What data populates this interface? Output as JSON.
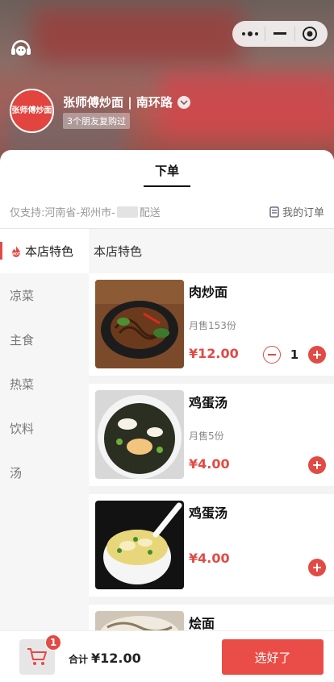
{
  "shop": {
    "name": "张师傅炒面 | 南环路",
    "logo_text": "张师傅炒面",
    "friends_badge": "3个朋友复购过"
  },
  "tabs": [
    {
      "label": "下单"
    }
  ],
  "notice": {
    "prefix": "仅支持:河南省-郑州市-",
    "suffix": "配送",
    "orders_link": "我的订单"
  },
  "categories": [
    {
      "label": "本店特色",
      "active": true
    },
    {
      "label": "凉菜"
    },
    {
      "label": "主食"
    },
    {
      "label": "热菜"
    },
    {
      "label": "饮料"
    },
    {
      "label": "汤"
    }
  ],
  "menu": {
    "section_title": "本店特色",
    "items": [
      {
        "name": "肉炒面",
        "sold": "月售153份",
        "price": "¥12.00",
        "count": "1"
      },
      {
        "name": "鸡蛋汤",
        "sold": "月售5份",
        "price": "¥4.00"
      },
      {
        "name": "鸡蛋汤",
        "sold": "",
        "price": "¥4.00"
      },
      {
        "name": "烩面",
        "sold": "",
        "price": ""
      }
    ]
  },
  "cart": {
    "badge": "1",
    "total_label": "合计",
    "total_value": "¥12.00",
    "checkout_label": "选好了"
  },
  "colors": {
    "accent": "#e24a45",
    "checkout_bg": "#ea4d48"
  }
}
